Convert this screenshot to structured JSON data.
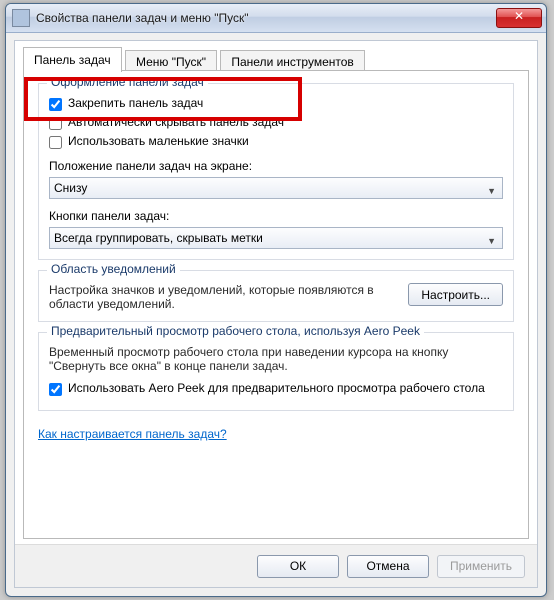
{
  "window": {
    "title": "Свойства панели задач и меню \"Пуск\""
  },
  "tabs": {
    "taskbar": "Панель задач",
    "startmenu": "Меню \"Пуск\"",
    "toolbars": "Панели инструментов"
  },
  "appearance": {
    "legend": "Оформление панели задач",
    "lock": "Закрепить панель задач",
    "autohide": "Автоматически скрывать панель задач",
    "smallicons": "Использовать маленькие значки"
  },
  "position": {
    "label": "Положение панели задач на экране:",
    "value": "Снизу"
  },
  "buttons": {
    "label": "Кнопки панели задач:",
    "value": "Всегда группировать, скрывать метки"
  },
  "notif": {
    "legend": "Область уведомлений",
    "desc": "Настройка значков и уведомлений, которые появляются в области уведомлений.",
    "btn": "Настроить..."
  },
  "peek": {
    "legend": "Предварительный просмотр рабочего стола, используя Aero Peek",
    "desc": "Временный просмотр рабочего стола при наведении курсора на кнопку \"Свернуть все окна\" в конце панели задач.",
    "chk": "Использовать Aero Peek для предварительного просмотра рабочего стола"
  },
  "link": "Как настраивается панель задач?",
  "footer": {
    "ok": "ОК",
    "cancel": "Отмена",
    "apply": "Применить"
  }
}
